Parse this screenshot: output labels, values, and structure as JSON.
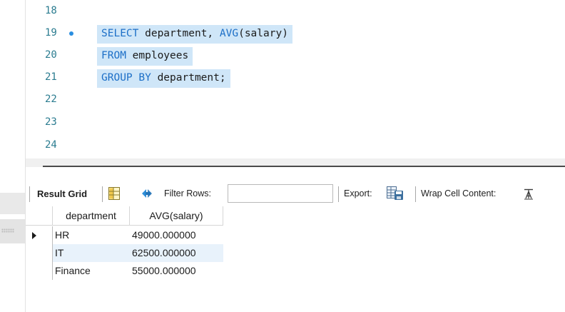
{
  "editor": {
    "lines": [
      {
        "num": "18",
        "code": ""
      },
      {
        "num": "19",
        "code": "SELECT department, AVG(salary)"
      },
      {
        "num": "20",
        "code": "FROM employees"
      },
      {
        "num": "21",
        "code": "GROUP BY department;"
      },
      {
        "num": "22",
        "code": ""
      },
      {
        "num": "23",
        "code": ""
      },
      {
        "num": "24",
        "code": ""
      }
    ]
  },
  "toolbar": {
    "result_grid_label": "Result Grid",
    "filter_rows_label": "Filter Rows:",
    "filter_value": "",
    "export_label": "Export:",
    "wrap_label": "Wrap Cell Content:",
    "icons": [
      "grid-form-icon",
      "refresh-arrows-icon",
      "export-icon",
      "wrap-text-icon"
    ]
  },
  "result_grid": {
    "columns": [
      "department",
      "AVG(salary)"
    ],
    "rows": [
      [
        "HR",
        "49000.000000"
      ],
      [
        "IT",
        "62500.000000"
      ],
      [
        "Finance",
        "55000.000000"
      ]
    ]
  },
  "colors": {
    "keyword": "#1c6fc7",
    "line_number": "#2b7c90",
    "selection": "#cfe6f8",
    "breakpoint": "#2a8ee0"
  }
}
